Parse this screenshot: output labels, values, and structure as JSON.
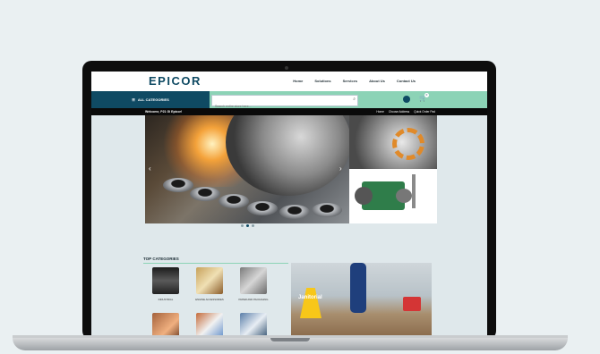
{
  "brand": {
    "logo": "EPICOR"
  },
  "nav": {
    "items": [
      "Home",
      "Solutions",
      "Services",
      "About Us",
      "Contact Us"
    ]
  },
  "catbar": {
    "all_categories": "ALL CATEGORIES",
    "search_placeholder": "Search entire store here..."
  },
  "cart": {
    "count": "0"
  },
  "welcome": {
    "text": "Welcome, P21 Gi Epicor!"
  },
  "crumbs": [
    "Home",
    "Choose Address",
    "Quick Order Pad"
  ],
  "top_categories": {
    "title": "TOP CATEGORIES",
    "items": [
      {
        "label": "INDUSTRIAL"
      },
      {
        "label": "ENGINE ACCESSORIES"
      },
      {
        "label": "PAPER AND PACKAGING"
      }
    ]
  },
  "promo": {
    "label": "Janitorial"
  },
  "colors": {
    "primary": "#0f4a63",
    "accent": "#8cd3b6"
  }
}
